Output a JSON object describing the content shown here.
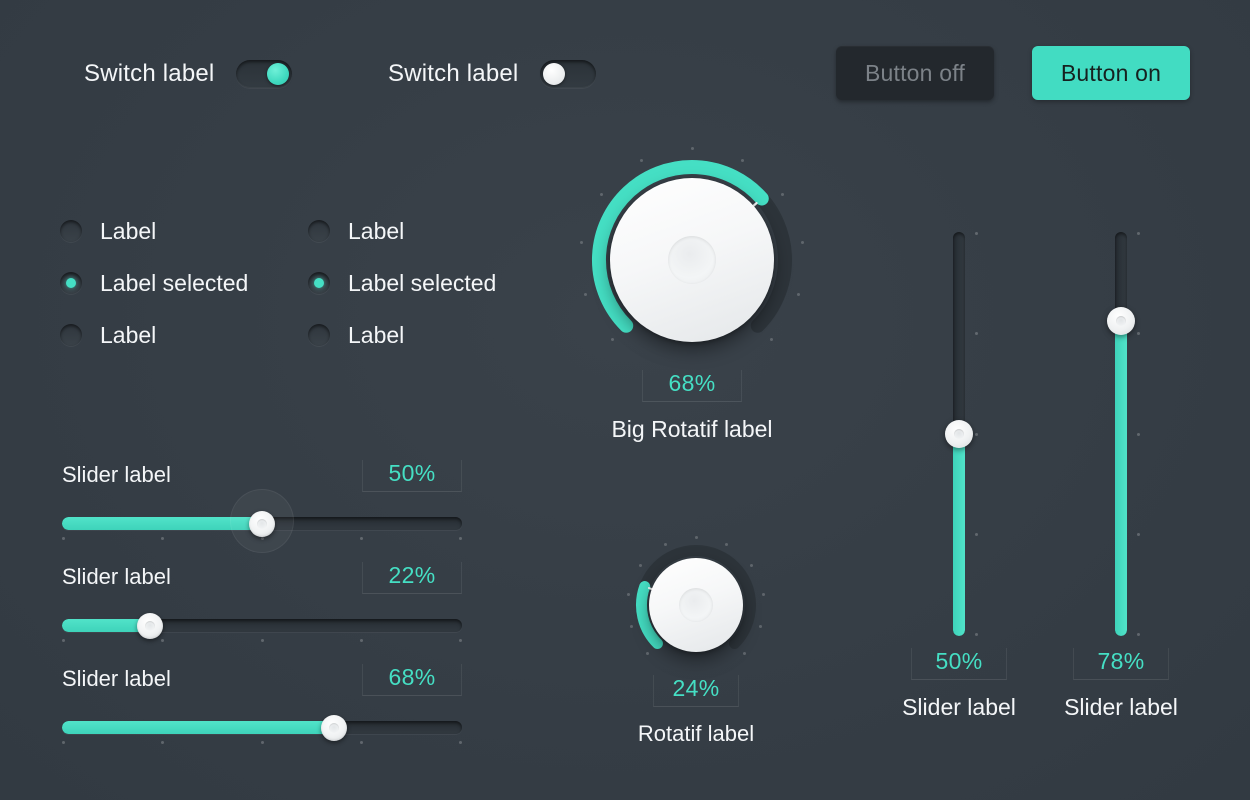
{
  "theme": {
    "background": "#373f47",
    "accent": "#45dfc4",
    "track_dark": "#2b3238",
    "text": "#f4f6f8",
    "muted_text": "#7c8288",
    "handle": "#ffffff"
  },
  "switches": [
    {
      "label": "Switch label",
      "state": "on"
    },
    {
      "label": "Switch label",
      "state": "off"
    }
  ],
  "buttons": [
    {
      "label": "Button off",
      "state": "off"
    },
    {
      "label": "Button on",
      "state": "on"
    }
  ],
  "radio_groups": [
    {
      "options": [
        {
          "label": "Label",
          "selected": false
        },
        {
          "label": "Label selected",
          "selected": true
        },
        {
          "label": "Label",
          "selected": false
        }
      ]
    },
    {
      "options": [
        {
          "label": "Label",
          "selected": false
        },
        {
          "label": "Label selected",
          "selected": true
        },
        {
          "label": "Label",
          "selected": false
        }
      ]
    }
  ],
  "horizontal_sliders": [
    {
      "label": "Slider label",
      "value": 50,
      "value_text": "50%",
      "focused": true
    },
    {
      "label": "Slider label",
      "value": 22,
      "value_text": "22%",
      "focused": false
    },
    {
      "label": "Slider label",
      "value": 68,
      "value_text": "68%",
      "focused": false
    }
  ],
  "rotaries": [
    {
      "caption": "Big Rotatif label",
      "value": 68,
      "value_text": "68%",
      "size": "big"
    },
    {
      "caption": "Rotatif label",
      "value": 24,
      "value_text": "24%",
      "size": "small"
    }
  ],
  "vertical_sliders": [
    {
      "caption": "Slider label",
      "value": 50,
      "value_text": "50%"
    },
    {
      "caption": "Slider label",
      "value": 78,
      "value_text": "78%"
    }
  ]
}
